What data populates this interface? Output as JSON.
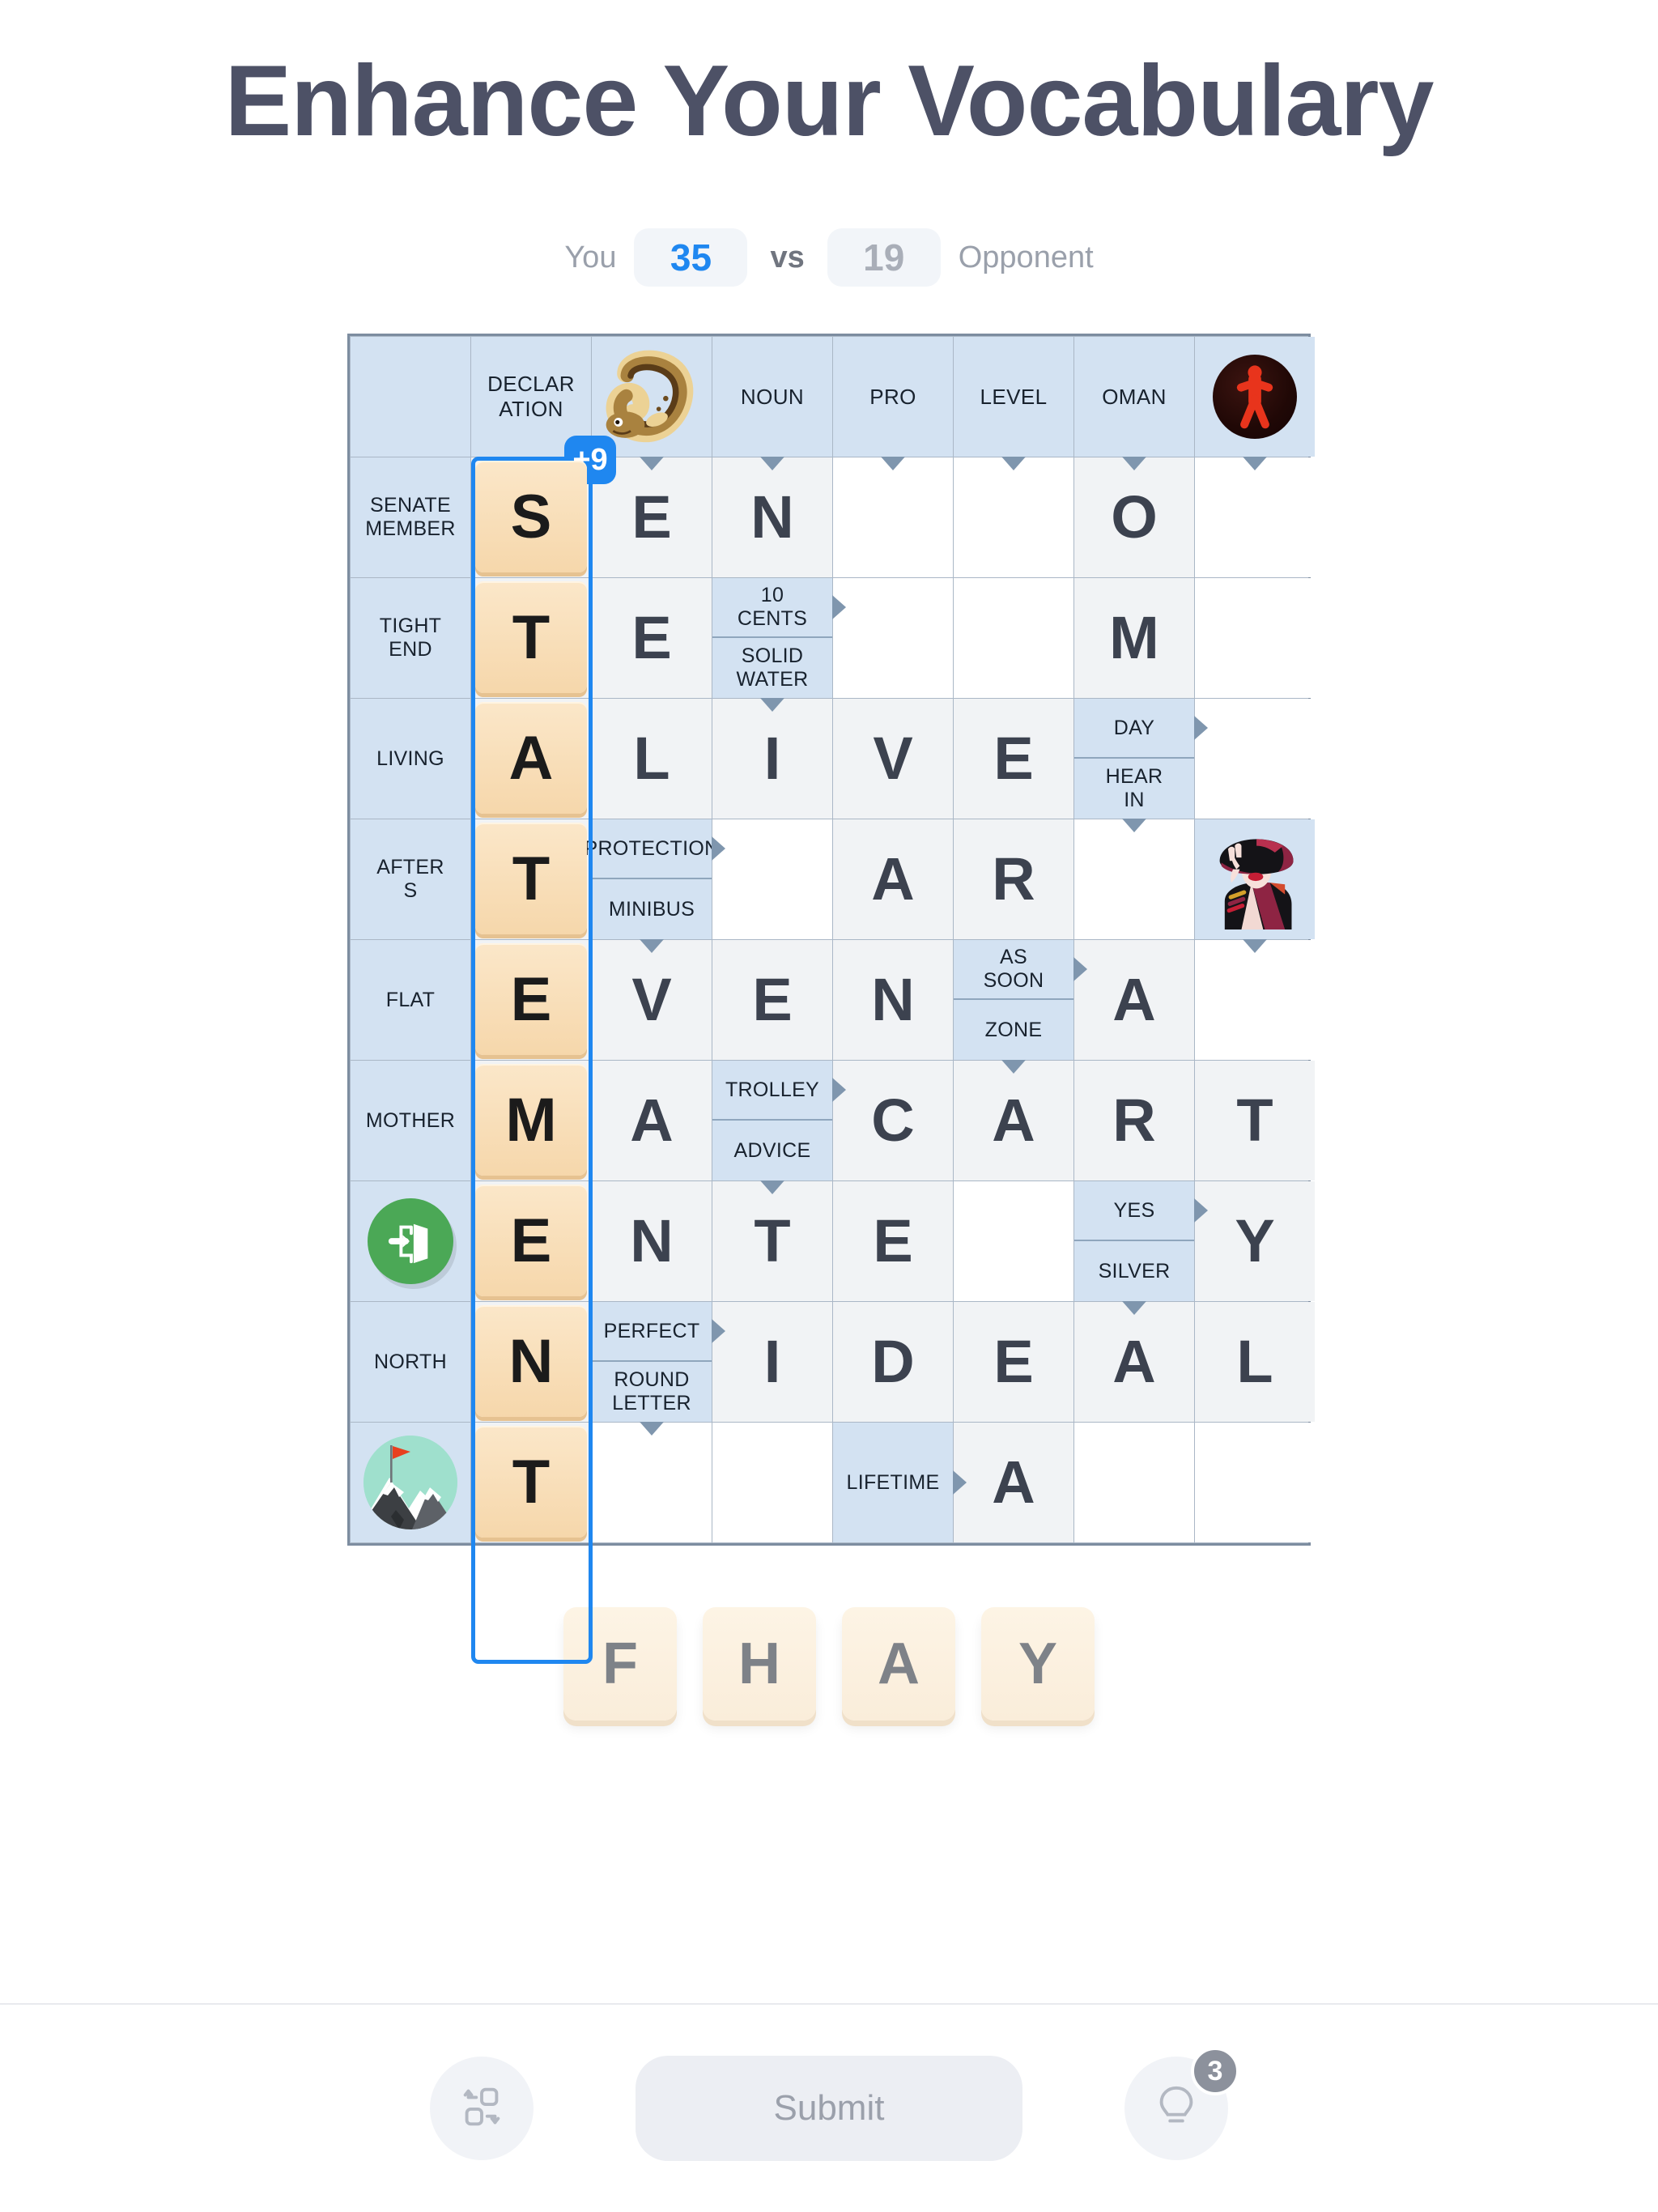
{
  "header": {
    "title": "Enhance Your Vocabulary"
  },
  "score": {
    "you_label": "You",
    "you_value": "35",
    "vs_label": "vs",
    "opponent_value": "19",
    "opponent_label": "Opponent",
    "you_color": "#1f87f0",
    "opponent_color": "#a9aeb8"
  },
  "selection": {
    "word": "STATEMENT",
    "points_badge": "+9",
    "column_index": 1,
    "accent_color": "#1f87f0"
  },
  "grid": {
    "columns": 8,
    "rows": 10,
    "column_headers": [
      {
        "type": "empty",
        "text": ""
      },
      {
        "type": "clue",
        "text": "DECLARATION",
        "display": "DECLAR ATION",
        "arrow": "down"
      },
      {
        "type": "icon",
        "icon": "eel-icon",
        "text": "",
        "arrow": "down"
      },
      {
        "type": "clue",
        "text": "NOUN",
        "arrow": "down"
      },
      {
        "type": "clue",
        "text": "PRO",
        "arrow": "down"
      },
      {
        "type": "clue",
        "text": "LEVEL",
        "arrow": "down"
      },
      {
        "type": "clue",
        "text": "OMAN",
        "arrow": "down"
      },
      {
        "type": "icon",
        "icon": "pedestrian-stop-signal-icon",
        "text": "",
        "arrow": "down"
      }
    ],
    "rows_data": [
      {
        "label": {
          "type": "clue",
          "text": "SENATE MEMBER"
        },
        "cells": [
          {
            "type": "tile",
            "letter": "S"
          },
          {
            "type": "letter",
            "letter": "E"
          },
          {
            "type": "letter",
            "letter": "N"
          },
          {
            "type": "blank",
            "letter": ""
          },
          {
            "type": "blank",
            "letter": ""
          },
          {
            "type": "letter",
            "letter": "O"
          },
          {
            "type": "blank",
            "letter": ""
          }
        ]
      },
      {
        "label": {
          "type": "clue",
          "text": "TIGHT END"
        },
        "cells": [
          {
            "type": "tile",
            "letter": "T"
          },
          {
            "type": "letter",
            "letter": "E"
          },
          {
            "type": "split-clue",
            "top": "10 CENTS",
            "bottom": "SOLID WATER",
            "arrow_top": "right",
            "arrow_bottom": "down"
          },
          {
            "type": "blank",
            "letter": ""
          },
          {
            "type": "blank",
            "letter": ""
          },
          {
            "type": "letter",
            "letter": "M"
          },
          {
            "type": "blank",
            "letter": ""
          }
        ]
      },
      {
        "label": {
          "type": "clue",
          "text": "LIVING"
        },
        "cells": [
          {
            "type": "tile",
            "letter": "A"
          },
          {
            "type": "letter",
            "letter": "L"
          },
          {
            "type": "letter",
            "letter": "I"
          },
          {
            "type": "letter",
            "letter": "V"
          },
          {
            "type": "letter",
            "letter": "E"
          },
          {
            "type": "split-clue",
            "top": "DAY",
            "bottom": "HEAR IN",
            "arrow_top": "right",
            "arrow_bottom": "down"
          },
          {
            "type": "blank",
            "letter": ""
          }
        ]
      },
      {
        "label": {
          "type": "clue",
          "text": "AFTER S"
        },
        "cells": [
          {
            "type": "tile",
            "letter": "T"
          },
          {
            "type": "split-clue",
            "top": "PROTECTION",
            "bottom": "MINIBUS",
            "arrow_top": "right",
            "arrow_bottom": "down"
          },
          {
            "type": "blank",
            "letter": ""
          },
          {
            "type": "letter",
            "letter": "A"
          },
          {
            "type": "letter",
            "letter": "R"
          },
          {
            "type": "blank",
            "letter": ""
          },
          {
            "type": "icon",
            "icon": "woman-with-hat-icon",
            "arrow_bottom": "down"
          }
        ]
      },
      {
        "label": {
          "type": "clue",
          "text": "FLAT"
        },
        "cells": [
          {
            "type": "tile",
            "letter": "E"
          },
          {
            "type": "letter",
            "letter": "V"
          },
          {
            "type": "letter",
            "letter": "E"
          },
          {
            "type": "letter",
            "letter": "N"
          },
          {
            "type": "split-clue",
            "top": "AS SOON",
            "bottom": "ZONE",
            "arrow_top": "right",
            "arrow_bottom": "down"
          },
          {
            "type": "letter",
            "letter": "A"
          },
          {
            "type": "blank",
            "letter": ""
          }
        ]
      },
      {
        "label": {
          "type": "clue",
          "text": "MOTHER"
        },
        "cells": [
          {
            "type": "tile",
            "letter": "M"
          },
          {
            "type": "letter",
            "letter": "A"
          },
          {
            "type": "split-clue",
            "top": "TROLLEY",
            "bottom": "ADVICE",
            "arrow_top": "right",
            "arrow_bottom": "down"
          },
          {
            "type": "letter",
            "letter": "C"
          },
          {
            "type": "letter",
            "letter": "A"
          },
          {
            "type": "letter",
            "letter": "R"
          },
          {
            "type": "letter",
            "letter": "T"
          }
        ]
      },
      {
        "label": {
          "type": "icon",
          "icon": "enter-door-icon"
        },
        "cells": [
          {
            "type": "tile",
            "letter": "E"
          },
          {
            "type": "letter",
            "letter": "N"
          },
          {
            "type": "letter",
            "letter": "T"
          },
          {
            "type": "letter",
            "letter": "E"
          },
          {
            "type": "blank",
            "letter": ""
          },
          {
            "type": "split-clue",
            "top": "YES",
            "bottom": "SILVER",
            "arrow_top": "right",
            "arrow_bottom": "down"
          },
          {
            "type": "letter",
            "letter": "Y"
          }
        ]
      },
      {
        "label": {
          "type": "clue",
          "text": "NORTH"
        },
        "cells": [
          {
            "type": "tile",
            "letter": "N"
          },
          {
            "type": "split-clue",
            "top": "PERFECT",
            "bottom": "ROUND LETTER",
            "arrow_top": "right",
            "arrow_bottom": "down"
          },
          {
            "type": "letter",
            "letter": "I"
          },
          {
            "type": "letter",
            "letter": "D"
          },
          {
            "type": "letter",
            "letter": "E"
          },
          {
            "type": "letter",
            "letter": "A"
          },
          {
            "type": "letter",
            "letter": "L"
          }
        ]
      },
      {
        "label": {
          "type": "icon",
          "icon": "snowy-mountain-icon"
        },
        "cells": [
          {
            "type": "tile",
            "letter": "T"
          },
          {
            "type": "blank",
            "letter": ""
          },
          {
            "type": "blank",
            "letter": ""
          },
          {
            "type": "clue",
            "text": "LIFETIME",
            "arrow": "right"
          },
          {
            "type": "letter",
            "letter": "A"
          },
          {
            "type": "blank",
            "letter": ""
          },
          {
            "type": "blank",
            "letter": ""
          }
        ]
      }
    ]
  },
  "rack": {
    "tiles": [
      "F",
      "H",
      "A",
      "Y"
    ]
  },
  "toolbar": {
    "shuffle_icon": "shuffle-icon",
    "submit_label": "Submit",
    "hint_icon": "lightbulb-hint-icon",
    "hint_count": "3"
  }
}
